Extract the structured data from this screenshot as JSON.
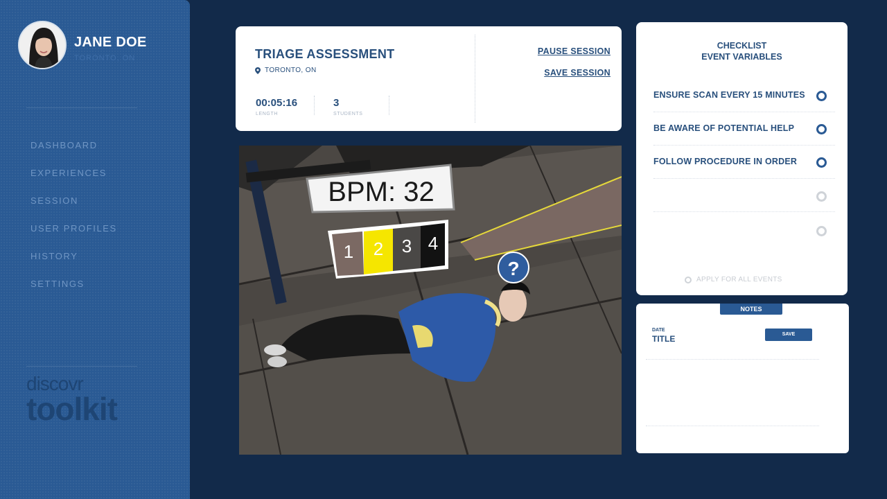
{
  "user": {
    "name": "JANE DOE",
    "location": "TORONTO, ON"
  },
  "nav": {
    "items": [
      {
        "label": "DASHBOARD"
      },
      {
        "label": "EXPERIENCES"
      },
      {
        "label": "SESSION"
      },
      {
        "label": "USER PROFILES"
      },
      {
        "label": "HISTORY"
      },
      {
        "label": "SETTINGS"
      }
    ]
  },
  "brand": {
    "line1": "discovr",
    "line2": "toolkit"
  },
  "session": {
    "title": "TRIAGE ASSESSMENT",
    "location": "TORONTO, ON",
    "length_value": "00:05:16",
    "length_label": "LENGTH",
    "students_value": "3",
    "students_label": "STUDENTS",
    "pause_label": "PAUSE SESSION",
    "save_label": "SAVE SESSION"
  },
  "scene": {
    "bpm_text": "BPM: 32",
    "triage_levels": [
      "1",
      "2",
      "3",
      "4"
    ],
    "selected_level": "2",
    "help_symbol": "?"
  },
  "checklist": {
    "title_line1": "CHECKLIST",
    "title_line2": "EVENT VARIABLES",
    "items": [
      {
        "label": "ENSURE SCAN EVERY 15 MINUTES"
      },
      {
        "label": "BE AWARE OF POTENTIAL HELP"
      },
      {
        "label": "FOLLOW PROCEDURE IN ORDER"
      },
      {
        "label": ""
      },
      {
        "label": ""
      }
    ],
    "apply_all_label": "APPLY FOR ALL EVENTS"
  },
  "notes": {
    "tab_label": "NOTES",
    "date_label": "DATE",
    "title_label": "TITLE",
    "save_label": "SAVE"
  },
  "colors": {
    "background": "#122a4a",
    "sidebar": "#2a5a94",
    "accent": "#2a5a94",
    "text_primary": "#284f7c",
    "highlight_yellow": "#f5e600"
  }
}
